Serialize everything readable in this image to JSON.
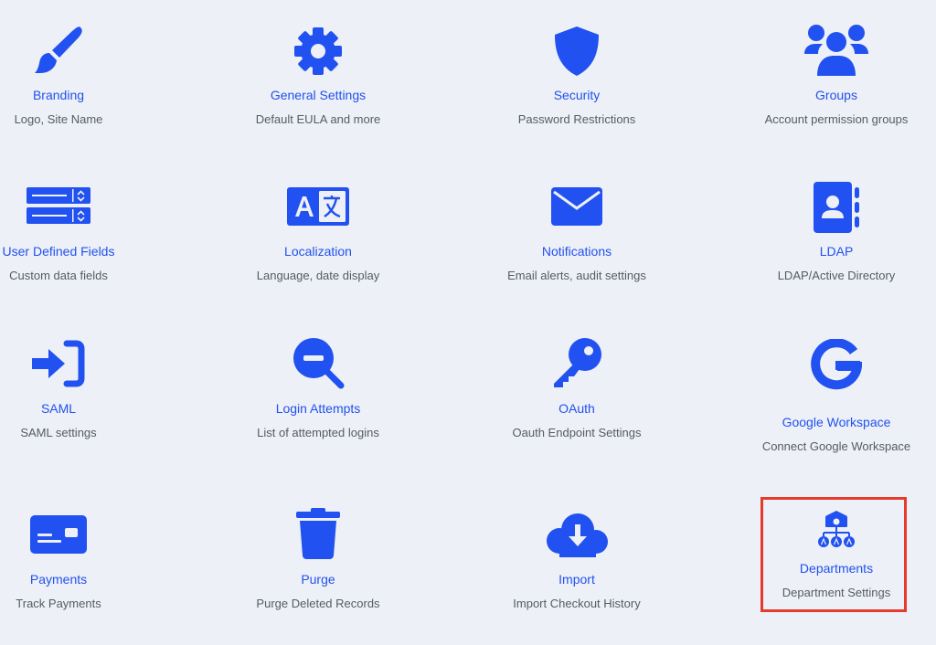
{
  "accent_color": "#2151f0",
  "highlight_color": "#e53a2c",
  "tiles": [
    {
      "id": "branding",
      "icon": "paintbrush-icon",
      "title": "Branding",
      "subtitle": "Logo, Site Name"
    },
    {
      "id": "general-settings",
      "icon": "gear-icon",
      "title": "General Settings",
      "subtitle": "Default EULA and more"
    },
    {
      "id": "security",
      "icon": "shield-icon",
      "title": "Security",
      "subtitle": "Password Restrictions"
    },
    {
      "id": "groups",
      "icon": "users-group-icon",
      "title": "Groups",
      "subtitle": "Account permission groups"
    },
    {
      "id": "user-defined-fields",
      "icon": "form-fields-icon",
      "title": "User Defined Fields",
      "subtitle": "Custom data fields"
    },
    {
      "id": "localization",
      "icon": "language-icon",
      "title": "Localization",
      "subtitle": "Language, date display"
    },
    {
      "id": "notifications",
      "icon": "envelope-icon",
      "title": "Notifications",
      "subtitle": "Email alerts, audit settings"
    },
    {
      "id": "ldap",
      "icon": "address-book-icon",
      "title": "LDAP",
      "subtitle": "LDAP/Active Directory"
    },
    {
      "id": "saml",
      "icon": "sign-in-icon",
      "title": "SAML",
      "subtitle": "SAML settings"
    },
    {
      "id": "login-attempts",
      "icon": "magnifier-minus-icon",
      "title": "Login Attempts",
      "subtitle": "List of attempted logins"
    },
    {
      "id": "oauth",
      "icon": "key-icon",
      "title": "OAuth",
      "subtitle": "Oauth Endpoint Settings"
    },
    {
      "id": "google-workspace",
      "icon": "google-icon",
      "title": "Google Workspace",
      "subtitle": "Connect Google Workspace"
    },
    {
      "id": "payments",
      "icon": "credit-card-icon",
      "title": "Payments",
      "subtitle": "Track Payments"
    },
    {
      "id": "purge",
      "icon": "trash-icon",
      "title": "Purge",
      "subtitle": "Purge Deleted Records"
    },
    {
      "id": "import",
      "icon": "cloud-download-icon",
      "title": "Import",
      "subtitle": "Import Checkout History"
    },
    {
      "id": "departments",
      "icon": "sitemap-icon",
      "title": "Departments",
      "subtitle": "Department Settings"
    }
  ]
}
